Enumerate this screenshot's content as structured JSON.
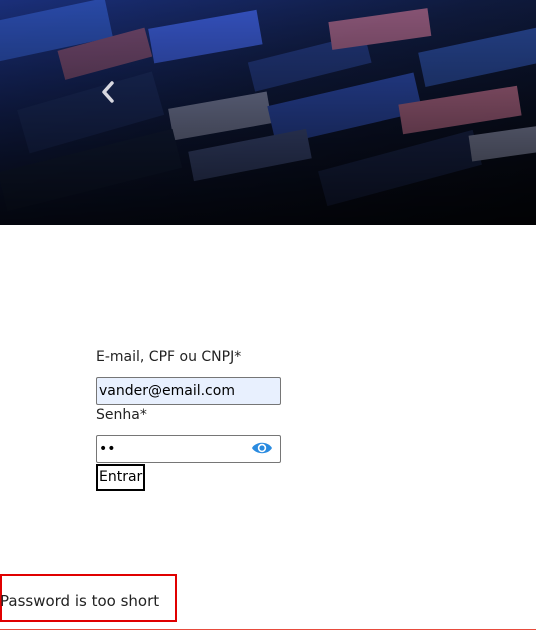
{
  "hero": {
    "prev_icon": "chevron-left-icon"
  },
  "login_form": {
    "email_label": "E-mail, CPF ou CNPJ*",
    "email_value": "vander@email.com",
    "password_label": "Senha*",
    "password_value": "••",
    "password_toggle_icon": "eye-icon",
    "submit_label": "Entrar"
  },
  "error": {
    "message": "Password is too short"
  },
  "colors": {
    "autofill_background": "#e8f0fe",
    "error_border": "#e00000",
    "eye_icon": "#2a8be0"
  }
}
